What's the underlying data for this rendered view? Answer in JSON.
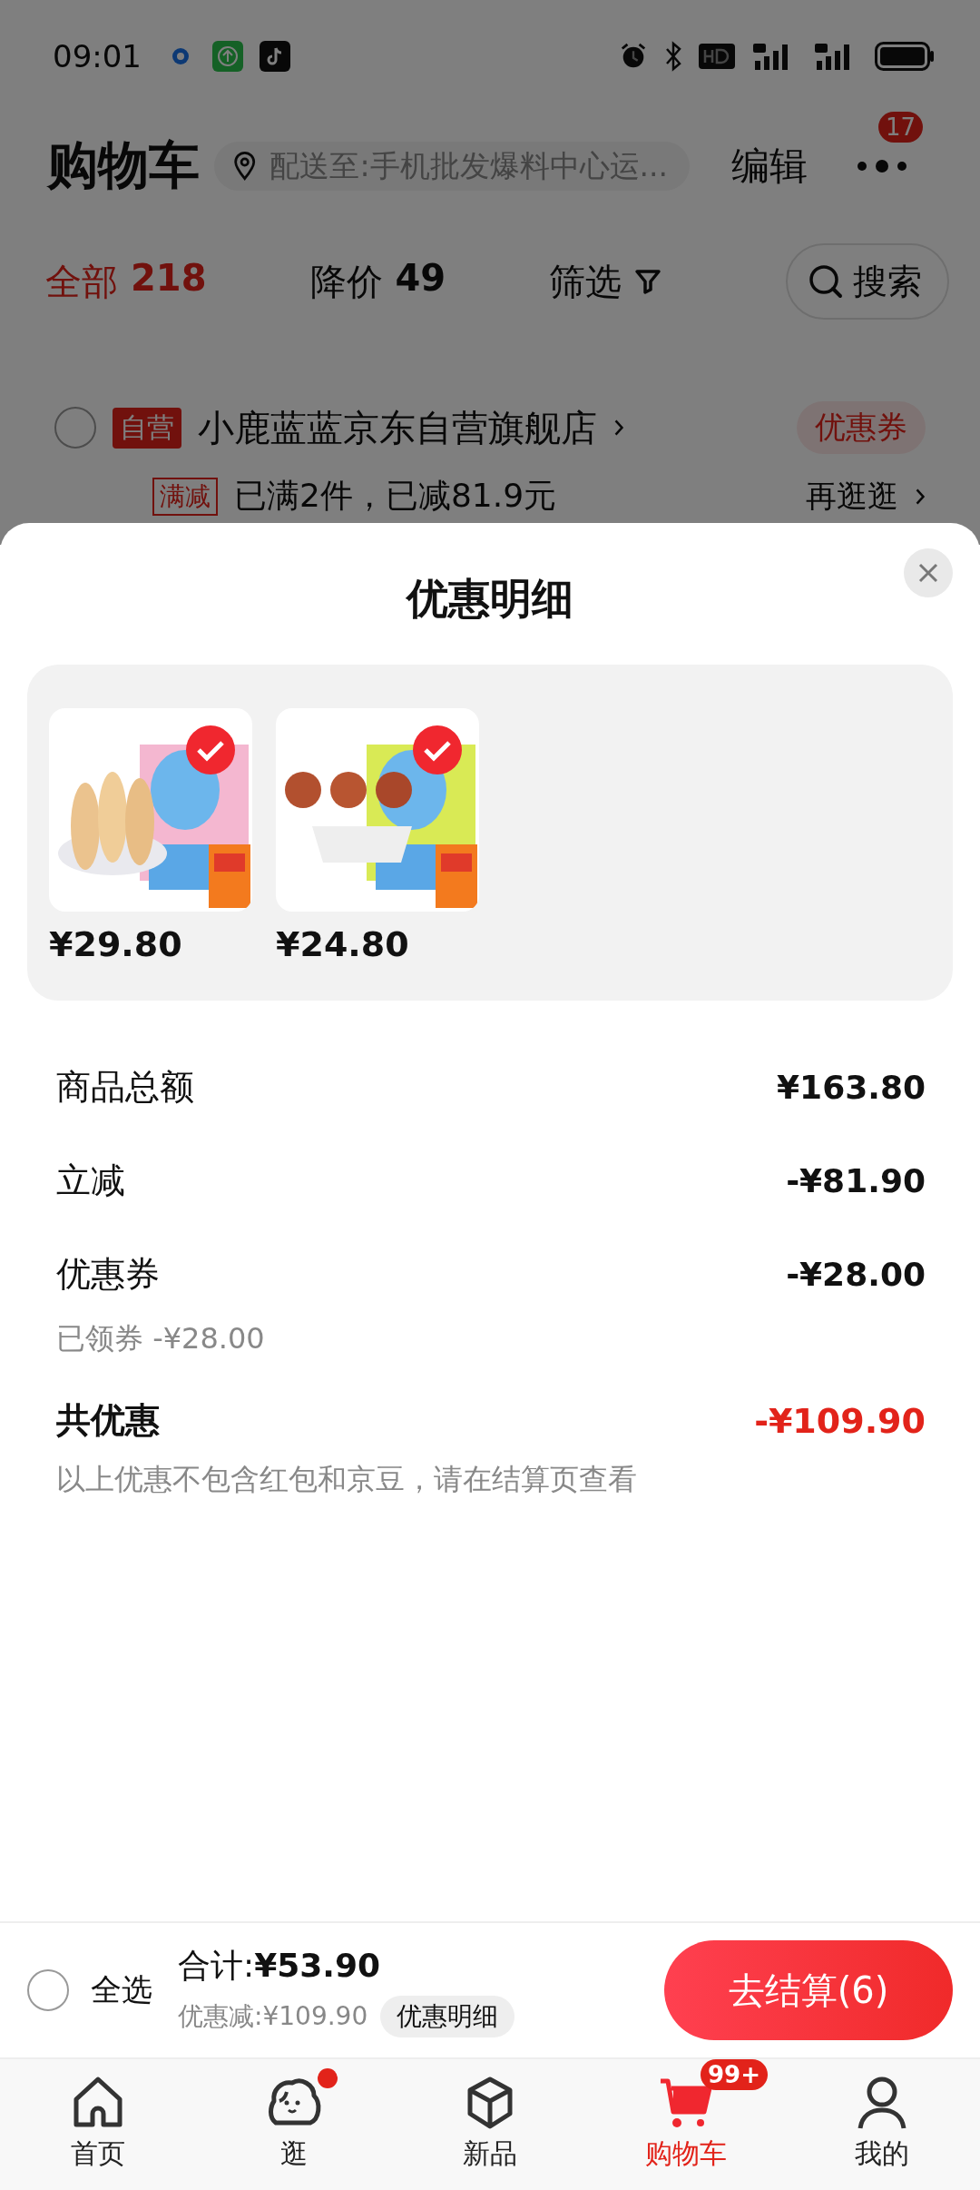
{
  "status_bar": {
    "time": "09:01"
  },
  "header": {
    "title": "购物车",
    "address": "配送至:手机批发爆料中心运...",
    "edit": "编辑",
    "more_badge": "17"
  },
  "filter_tabs": [
    {
      "label": "全部",
      "count": "218",
      "selected": true
    },
    {
      "label": "降价",
      "count": "49",
      "selected": false
    }
  ],
  "filter": "筛选",
  "search": "搜索",
  "store": {
    "checked": false,
    "tag": "自营",
    "name": "小鹿蓝蓝京东自营旗舰店",
    "coupon": "优惠券",
    "promo_tag": "满减",
    "promo_text": "已满2件，已减81.9元",
    "promo_link": "再逛逛"
  },
  "sheet": {
    "title": "优惠明细",
    "products": [
      {
        "kind": "picture",
        "price": "¥29.80",
        "checked": true
      },
      {
        "kind": "picture",
        "price": "¥24.80",
        "checked": true
      }
    ],
    "rows": [
      {
        "kind": "line",
        "label": "商品总额",
        "value": "¥163.80"
      },
      {
        "kind": "line",
        "label": "立减",
        "value": "-¥81.90"
      },
      {
        "kind": "line",
        "label": "优惠券",
        "value": "-¥28.00",
        "sub": "已领券 -¥28.00"
      },
      {
        "kind": "total",
        "label": "共优惠",
        "value": "-¥109.90"
      }
    ],
    "note": "以上优惠不包含红包和京豆，请在结算页查看"
  },
  "bottom_bar": {
    "select_all": {
      "label": "全选",
      "checked": false
    },
    "total_label": "合计:",
    "total": "¥53.90",
    "discount": "优惠减:¥109.90",
    "detail_button": "优惠明细",
    "checkout": "去结算(6)"
  },
  "nav": [
    {
      "kind": "home",
      "label": "首页",
      "selected": false
    },
    {
      "kind": "stroll",
      "label": "逛",
      "selected": false,
      "dot": true
    },
    {
      "kind": "new",
      "label": "新品",
      "selected": false
    },
    {
      "kind": "cart",
      "label": "购物车",
      "selected": true,
      "badge": "99+"
    },
    {
      "kind": "me",
      "label": "我的",
      "selected": false
    }
  ]
}
